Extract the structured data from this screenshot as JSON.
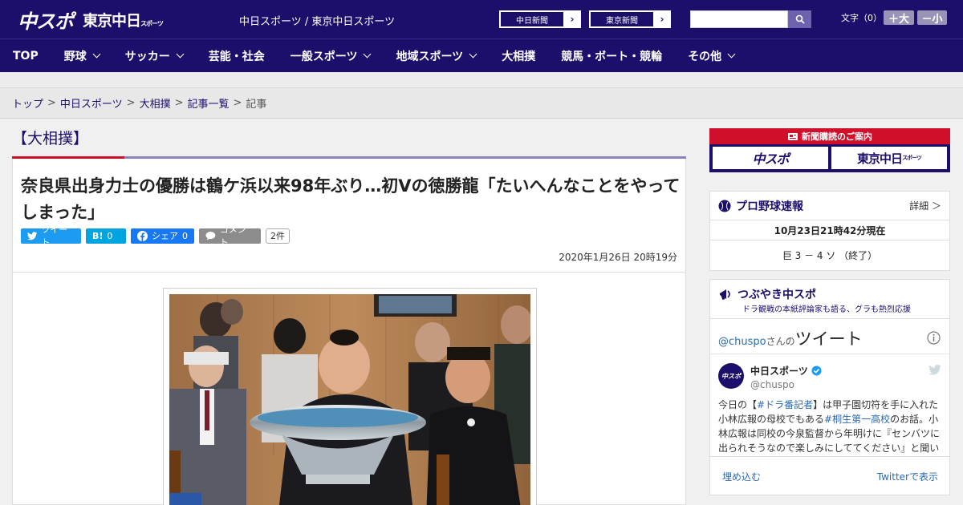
{
  "header": {
    "logo_main": "中スポ",
    "logo_sub": "東京中日",
    "logo_sub_small": "スポーツ",
    "tagline": "中日スポーツ / 東京中日スポーツ",
    "btn_chunichi": "中日新聞",
    "btn_tokyo": "東京新聞",
    "arrow": "›",
    "search_placeholder": "",
    "fontsize_label": "文字（0）",
    "font_plus": "＋大",
    "font_minus": "－小"
  },
  "nav": {
    "items": [
      {
        "label": "TOP",
        "dropdown": false
      },
      {
        "label": "野球",
        "dropdown": true
      },
      {
        "label": "サッカー",
        "dropdown": true
      },
      {
        "label": "芸能・社会",
        "dropdown": false
      },
      {
        "label": "一般スポーツ",
        "dropdown": true
      },
      {
        "label": "地域スポーツ",
        "dropdown": true
      },
      {
        "label": "大相撲",
        "dropdown": false
      },
      {
        "label": "競馬・ボート・競輪",
        "dropdown": false
      },
      {
        "label": "その他",
        "dropdown": true
      }
    ]
  },
  "breadcrumb": {
    "items": [
      "トップ",
      "中日スポーツ",
      "大相撲",
      "記事一覧"
    ],
    "current": "記事",
    "sep": ">"
  },
  "article": {
    "section": "【大相撲】",
    "headline": "奈良県出身力士の優勝は鶴ケ浜以来98年ぶり…初Vの徳勝龍「たいへんなことをやってしまった」",
    "tweet": "ツイート",
    "hatena": "B!",
    "hatena_count": "0",
    "facebook": "シェア",
    "facebook_count": "0",
    "comment": "コメント",
    "comment_count": "2件",
    "date": "2020年1月26日 20時19分"
  },
  "sidebar": {
    "ad_title": "新聞購読のご案内",
    "ad_btn1": "中スポ",
    "ad_btn2": "東京中日",
    "ad_btn2_small": "スポーツ",
    "baseball": {
      "title": "プロ野球速報",
      "more": "詳細 ＞",
      "timestamp": "10月23日21時42分現在",
      "score": "巨 3 － 4 ソ （終了）"
    },
    "tsubuyaki": {
      "title": "つぶやき中スポ",
      "subtitle": "ドラ観戦の本紙評論家も語る、グラも熱烈応援",
      "handle_prefix": "@chuspo",
      "handle_suffix": "さんの",
      "tweets_label": "ツイート",
      "account_name": "中日スポーツ",
      "account_handle": "@chuspo",
      "text_line1_a": "今日の【",
      "text_line1_link": "#ドラ番記者",
      "text_line1_b": "】は甲子園切符を手に入れた",
      "text_line2_a": "小林広報の母校でもある",
      "text_line2_link": "#桐生第一高校",
      "text_line2_b": "のお話。小",
      "text_line3": "林広報は同校の今泉監督から年明けに『センバツに",
      "text_line4": "出られそうなので楽しみにしててください』と聞い",
      "embed": "埋め込む",
      "view_on_twitter": "Twitterで表示"
    }
  },
  "colors": {
    "brand": "#1c0f6b",
    "accent_red": "#d0102a",
    "twitter": "#1d9bf0",
    "hatena": "#00a4de",
    "facebook": "#1877f2",
    "comment": "#8c8c8c"
  }
}
